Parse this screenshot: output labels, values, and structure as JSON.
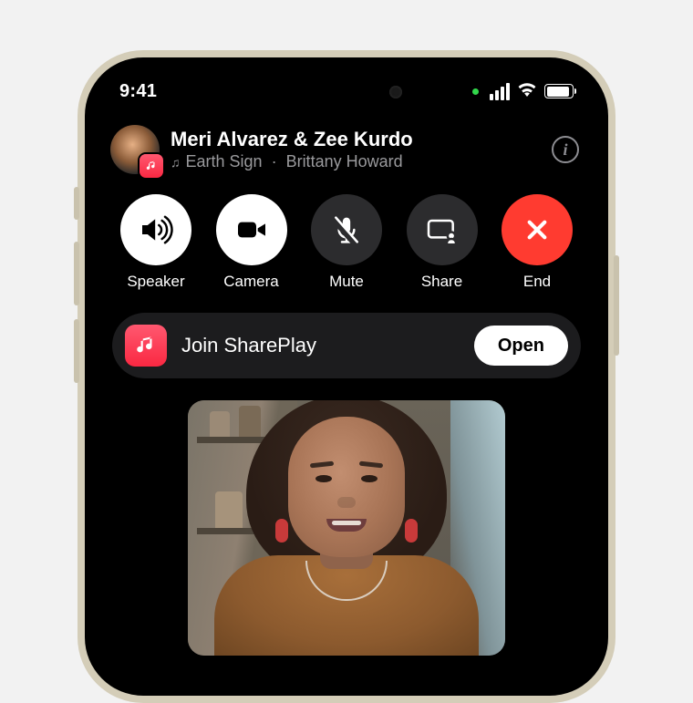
{
  "status_bar": {
    "time": "9:41"
  },
  "header": {
    "participants": "Meri Alvarez & Zee Kurdo",
    "song": "Earth Sign",
    "artist": "Brittany Howard",
    "separator": "·"
  },
  "controls": {
    "speaker": "Speaker",
    "camera": "Camera",
    "mute": "Mute",
    "share": "Share",
    "end": "End"
  },
  "shareplay": {
    "title": "Join SharePlay",
    "open_label": "Open"
  },
  "colors": {
    "music_app": "#fa2842",
    "end_call": "#ff3b30"
  }
}
